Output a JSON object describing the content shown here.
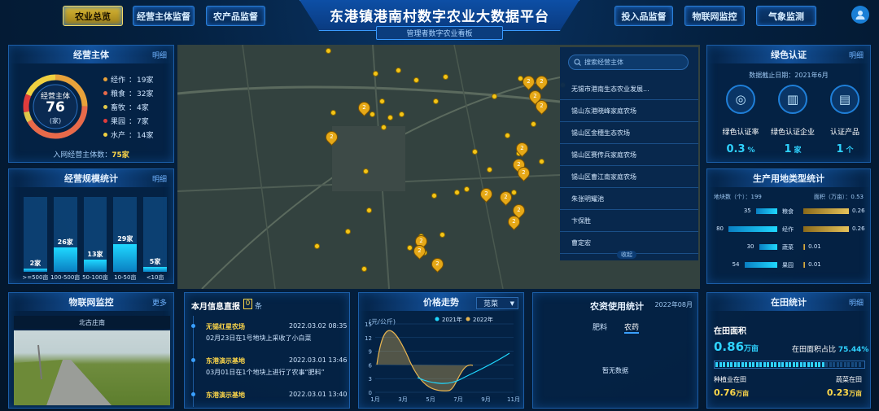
{
  "nav": {
    "left": [
      "农业总览",
      "经营主体监督",
      "农产品监督"
    ],
    "right": [
      "投入品监督",
      "物联网监控",
      "气象监测"
    ],
    "title": "东港镇港南村数字农业大数据平台",
    "subtitle": "管理者数字农业看板"
  },
  "entity": {
    "title": "经营主体",
    "link": "明细",
    "center_label": "经营主体",
    "center_value": "76",
    "center_unit": "(家)",
    "items": [
      {
        "name": "经作",
        "value": "19家",
        "color": "#e8a23a"
      },
      {
        "name": "粮食",
        "value": "32家",
        "color": "#e86a4a"
      },
      {
        "name": "畜牧",
        "value": "4家",
        "color": "#e0c94a"
      },
      {
        "name": "果园",
        "value": "7家",
        "color": "#e03c3c"
      },
      {
        "name": "水产",
        "value": "14家",
        "color": "#f0d040"
      }
    ],
    "footer_label": "入网经营主体数：",
    "footer_value": "75家"
  },
  "scale": {
    "title": "经营规模统计",
    "link": "明细",
    "bars": [
      {
        "label": ">=500亩",
        "value": 2,
        "text": "2家"
      },
      {
        "label": "100-500亩",
        "value": 26,
        "text": "26家"
      },
      {
        "label": "50-100亩",
        "value": 13,
        "text": "13家"
      },
      {
        "label": "10-50亩",
        "value": 29,
        "text": "29家"
      },
      {
        "label": "<10亩",
        "value": 5,
        "text": "5家"
      }
    ]
  },
  "iot": {
    "title": "物联网监控",
    "link": "更多",
    "camera": "北古庄南"
  },
  "news": {
    "title": "本月信息直报",
    "count": "0",
    "unit": "条",
    "items": [
      {
        "org": "无锡红星农场",
        "date": "2022.03.02 08:35",
        "text": "02月23日在1号地块上采收了小白菜"
      },
      {
        "org": "东港演示基地",
        "date": "2022.03.01 13:46",
        "text": "03月01日在1个地块上进行了农事“肥料”"
      },
      {
        "org": "东港演示基地",
        "date": "2022.03.01 13:40",
        "text": ""
      }
    ]
  },
  "price": {
    "title": "价格走势",
    "select": "苋菜",
    "unit": "(元/公斤)",
    "legend": [
      "2021年",
      "2022年"
    ],
    "yticks": [
      "15",
      "12",
      "9",
      "6",
      "3",
      "0"
    ],
    "xticks": [
      "1月",
      "3月",
      "5月",
      "7月",
      "9月",
      "11月"
    ]
  },
  "supplies": {
    "title": "农资使用统计",
    "date": "2022年08月",
    "tabs": [
      "肥料",
      "农药"
    ],
    "empty": "暂无数据"
  },
  "map": {
    "search_placeholder": "搜索经营主体",
    "list": [
      "无锡市港南生态农业发展...",
      "锡山东港晓峰家庭农场",
      "锡山区金穗生态农场",
      "锡山区赛传兵家庭农场",
      "锡山区曹江南家庭农场",
      "朱张明耀池",
      "卞保胜",
      "曹定宏"
    ],
    "collapse": "收起"
  },
  "green": {
    "title": "绿色认证",
    "link": "明细",
    "date": "数据截止日期：2021年6月",
    "items": [
      {
        "label": "绿色认证率",
        "value": "0.3",
        "unit": "%"
      },
      {
        "label": "绿色认证企业",
        "value": "1",
        "unit": "家"
      },
      {
        "label": "认证产品",
        "value": "1",
        "unit": "个"
      }
    ]
  },
  "land": {
    "title": "生产用地类型统计",
    "left_head": "地块数（个）：",
    "left_total": "199",
    "right_head": "面积（万亩）：",
    "right_total": "0.53",
    "rows": [
      {
        "name": "粮食",
        "count": 35,
        "area": 0.26
      },
      {
        "name": "经作",
        "count": 80,
        "area": 0.26
      },
      {
        "name": "蔬菜",
        "count": 30,
        "area": 0.01
      },
      {
        "name": "果园",
        "count": 54,
        "area": 0.01
      }
    ]
  },
  "field": {
    "title": "在田统计",
    "link": "明细",
    "area_label": "在田面积",
    "area_value": "0.86",
    "area_unit": "万亩",
    "ratio_label": "在田面积占比",
    "ratio_value": "75.44%",
    "ratio": 0.7544,
    "grain_label": "种植业在田",
    "grain_value": "0.76",
    "grain_unit": "万亩",
    "veg_label": "蔬菜在田",
    "veg_value": "0.23",
    "veg_unit": "万亩"
  }
}
